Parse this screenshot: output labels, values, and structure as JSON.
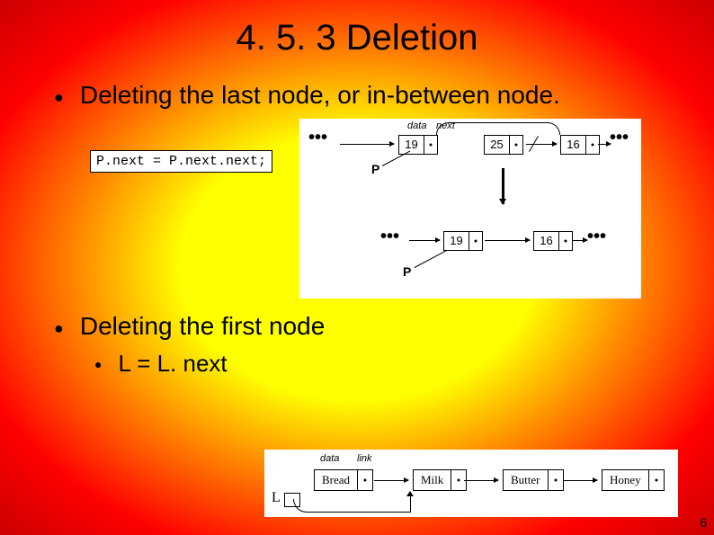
{
  "title": "4. 5. 3 Deletion",
  "bullet1": "Deleting the last node, or in-between node.",
  "code": "P.next = P.next.next;",
  "diagram1": {
    "label_data": "data",
    "label_next": "next",
    "p": "P",
    "nodes_row1": [
      "19",
      "25",
      "16"
    ],
    "nodes_row2": [
      "19",
      "16"
    ]
  },
  "bullet2": "Deleting the first node",
  "sub_bullet": "L = L. next",
  "diagram2": {
    "label_data": "data",
    "label_link": "link",
    "l": "L",
    "items": [
      "Bread",
      "Milk",
      "Butter",
      "Honey"
    ]
  },
  "page_number": "6"
}
